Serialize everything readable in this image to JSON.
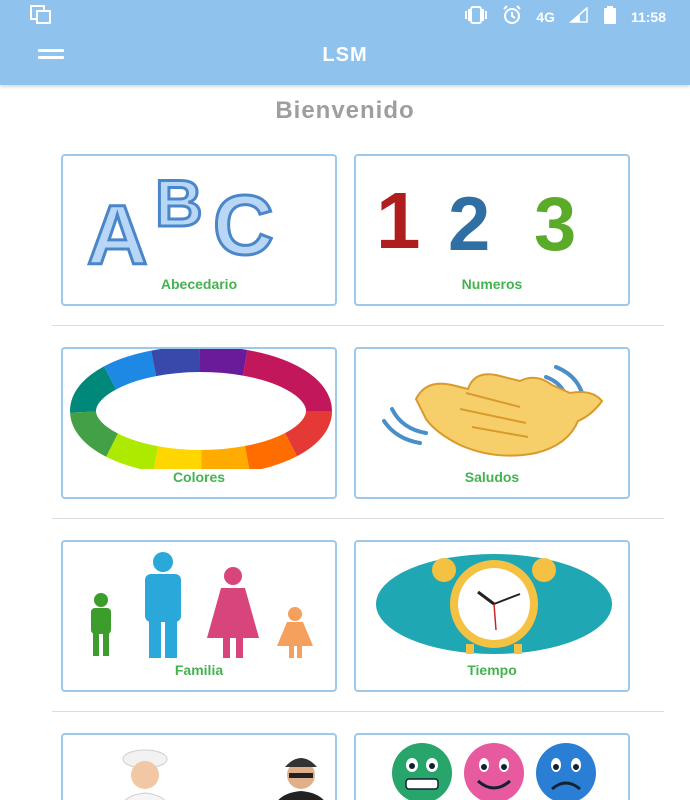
{
  "status_bar": {
    "network": "4G",
    "time": "11:58",
    "icons": [
      "screenshot-icon",
      "vibrate-icon",
      "alarm-icon",
      "signal-icon",
      "battery-icon"
    ]
  },
  "app_bar": {
    "title": "LSM",
    "menu_icon": "hamburger-menu-icon"
  },
  "welcome_text": "Bienvenido",
  "categories": [
    {
      "label": "Abecedario",
      "icon": "abc-letters-icon"
    },
    {
      "label": "Numeros",
      "icon": "numbers-123-icon"
    },
    {
      "label": "Colores",
      "icon": "color-wheel-icon"
    },
    {
      "label": "Saludos",
      "icon": "waving-hand-icon"
    },
    {
      "label": "Familia",
      "icon": "family-icon"
    },
    {
      "label": "Tiempo",
      "icon": "clock-icon"
    },
    {
      "label": "",
      "icon": "professions-icon"
    },
    {
      "label": "",
      "icon": "emotions-icon"
    }
  ],
  "colors": {
    "app_bar": "#8fc3ee",
    "card_border": "#9cc9ec",
    "label": "#43b34f",
    "welcome": "#9e9e9e"
  }
}
